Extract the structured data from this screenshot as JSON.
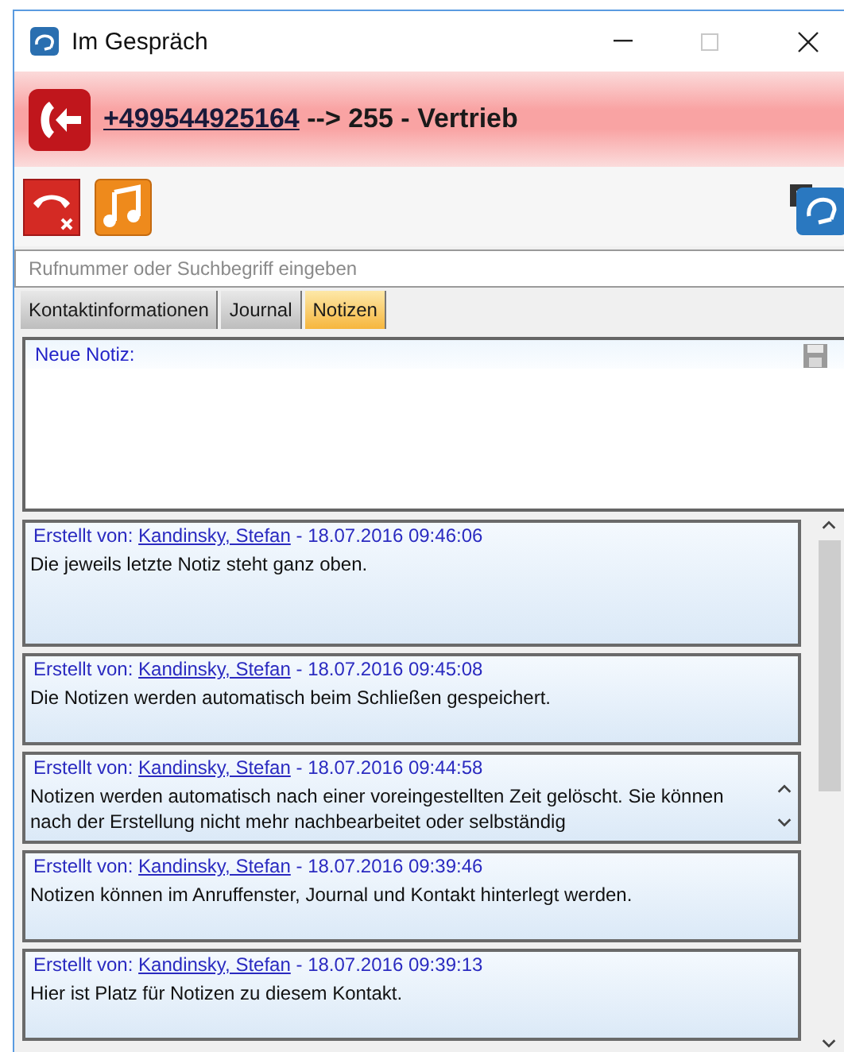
{
  "window": {
    "title": "Im Gespräch",
    "controls": [
      {
        "kind": "minimize",
        "disabled": false
      },
      {
        "kind": "maximize",
        "disabled": true
      },
      {
        "kind": "close",
        "disabled": false
      }
    ]
  },
  "call": {
    "number": "+499544925164",
    "target": "--> 255 - Vertrieb"
  },
  "search": {
    "placeholder": "Rufnummer oder Suchbegriff eingeben"
  },
  "tabs": [
    {
      "label": "Kontaktinformationen",
      "selected": false
    },
    {
      "label": "Journal",
      "selected": false
    },
    {
      "label": "Notizen",
      "selected": true
    }
  ],
  "new_note": {
    "label": "Neue Notiz:"
  },
  "notes": [
    {
      "created_label": "Erstellt von:",
      "author": "Kandinsky, Stefan",
      "timestamp": "- 18.07.2016 09:46:06",
      "text": "Die jeweils letzte Notiz steht ganz oben.",
      "scrollable": false
    },
    {
      "created_label": "Erstellt von:",
      "author": "Kandinsky, Stefan",
      "timestamp": "- 18.07.2016 09:45:08",
      "text": "Die Notizen werden automatisch beim Schließen gespeichert.",
      "scrollable": false
    },
    {
      "created_label": "Erstellt von:",
      "author": "Kandinsky, Stefan",
      "timestamp": "- 18.07.2016 09:44:58",
      "text": "Notizen werden automatisch nach einer voreingestellten Zeit gelöscht. Sie können nach der Erstellung nicht mehr nachbearbeitet oder selbständig",
      "scrollable": true
    },
    {
      "created_label": "Erstellt von:",
      "author": "Kandinsky, Stefan",
      "timestamp": "- 18.07.2016 09:39:46",
      "text": "Notizen können im Anruffenster, Journal und Kontakt hinterlegt werden.",
      "scrollable": false
    },
    {
      "created_label": "Erstellt von:",
      "author": "Kandinsky, Stefan",
      "timestamp": "- 18.07.2016 09:39:13",
      "text": "Hier ist Platz für Notizen zu diesem Kontakt.",
      "scrollable": false
    }
  ]
}
